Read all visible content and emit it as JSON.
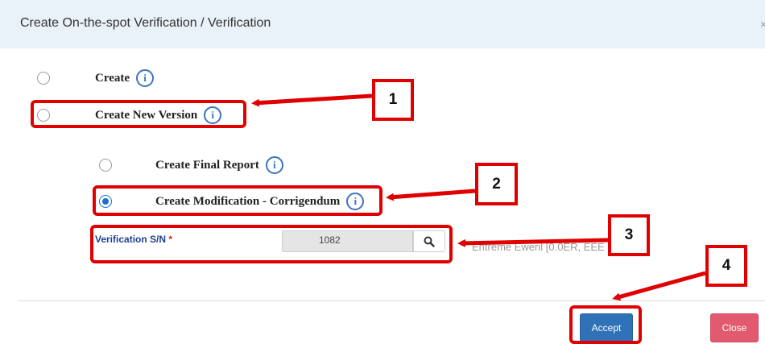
{
  "dialog": {
    "title": "Create On-the-spot Verification / Verification",
    "close_glyph": "×"
  },
  "options": {
    "create": {
      "label": "Create",
      "selected": false
    },
    "create_new_version": {
      "label": "Create New Version",
      "selected": false
    },
    "create_final_report": {
      "label": "Create Final Report",
      "selected": false
    },
    "create_modification": {
      "label": "Create Modification - Corrigendum",
      "selected": true
    },
    "info_glyph": "i"
  },
  "verification": {
    "label": "Verification S/N",
    "required_mark": "*",
    "value": "1082",
    "result_text": "Entreme Eweril [0.0ER, EEE"
  },
  "footer": {
    "accept_label": "Accept",
    "close_label": "Close"
  },
  "annotations": {
    "numbers": [
      "1",
      "2",
      "3",
      "4"
    ],
    "color": "#e00000"
  }
}
